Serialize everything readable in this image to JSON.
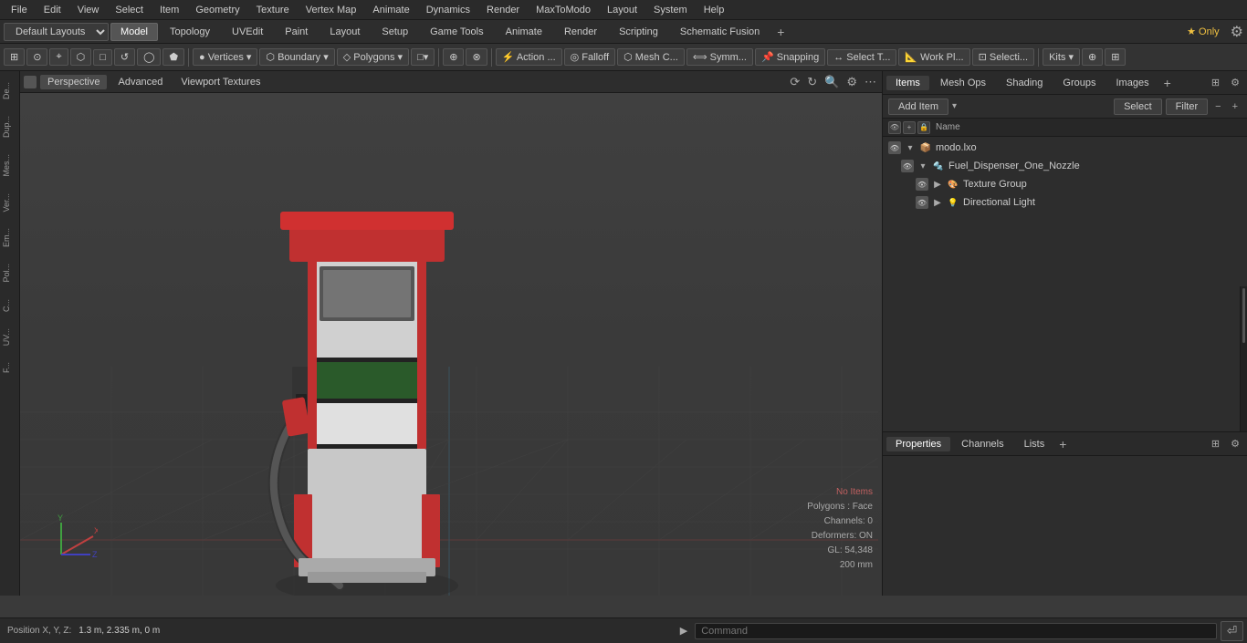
{
  "menubar": {
    "items": [
      "File",
      "Edit",
      "View",
      "Select",
      "Item",
      "Geometry",
      "Texture",
      "Vertex Map",
      "Animate",
      "Dynamics",
      "Render",
      "MaxToModo",
      "Layout",
      "System",
      "Help"
    ]
  },
  "layouts_bar": {
    "dropdown": "Default Layouts ▼",
    "tabs": [
      "Model",
      "Topology",
      "UVEdit",
      "Paint",
      "Layout",
      "Setup",
      "Game Tools",
      "Animate",
      "Render",
      "Scripting",
      "Schematic Fusion"
    ],
    "active_tab": "Model",
    "add_label": "+",
    "star_label": "★ Only"
  },
  "toolbar": {
    "tools": [
      "⊞",
      "⊙",
      "⌖",
      "⬡",
      "□",
      "↺",
      "◯",
      "⬟",
      "Vertices ▼",
      "Boundary ▼",
      "Polygons ▼",
      "□▼",
      "⊕",
      "⊗",
      "Action ...",
      "Falloff",
      "Mesh C...",
      "Symm...",
      "Snapping",
      "Select T...",
      "Work Pl...",
      "Selecti...",
      "Kits ▼",
      "⊕",
      "⊞"
    ]
  },
  "viewport": {
    "dot": "",
    "tabs": [
      "Perspective",
      "Advanced",
      "Viewport Textures"
    ],
    "active_tab": "Perspective",
    "icons": [
      "⟳",
      "↻",
      "🔍",
      "⚙",
      "⋯"
    ]
  },
  "left_sidebar": {
    "items": [
      "De...",
      "Dup...",
      "Mes...",
      "Ver...",
      "Em...",
      "Pol...",
      "C...",
      "UV...",
      "F..."
    ]
  },
  "info_overlay": {
    "no_items": "No Items",
    "polygons": "Polygons : Face",
    "channels": "Channels: 0",
    "deformers": "Deformers: ON",
    "gl": "GL: 54,348",
    "units": "200 mm"
  },
  "status_bar": {
    "position_label": "Position X, Y, Z:",
    "position_value": "1.3 m, 2.335 m, 0 m"
  },
  "right_panel": {
    "top_tabs": [
      "Items",
      "Mesh Ops",
      "Shading",
      "Groups",
      "Images"
    ],
    "active_tab": "Items",
    "add_label": "+",
    "items_header": {
      "add_item": "Add Item",
      "add_dropdown": "▼",
      "select": "Select",
      "filter": "Filter",
      "minus": "−",
      "plus": "+"
    },
    "col_header": {
      "name": "Name"
    },
    "items": [
      {
        "level": 0,
        "expanded": true,
        "icon": "📦",
        "label": "modo.lxo",
        "vis": true
      },
      {
        "level": 1,
        "expanded": true,
        "icon": "🔩",
        "label": "Fuel_Dispenser_One_Nozzle",
        "vis": true
      },
      {
        "level": 2,
        "expanded": false,
        "icon": "🎨",
        "label": "Texture Group",
        "vis": true
      },
      {
        "level": 2,
        "expanded": false,
        "icon": "💡",
        "label": "Directional Light",
        "vis": true
      }
    ]
  },
  "properties_panel": {
    "tabs": [
      "Properties",
      "Channels",
      "Lists"
    ],
    "active_tab": "Properties",
    "add_label": "+"
  },
  "command_bar": {
    "arrow": "▶",
    "placeholder": "Command",
    "button": "⏎"
  }
}
